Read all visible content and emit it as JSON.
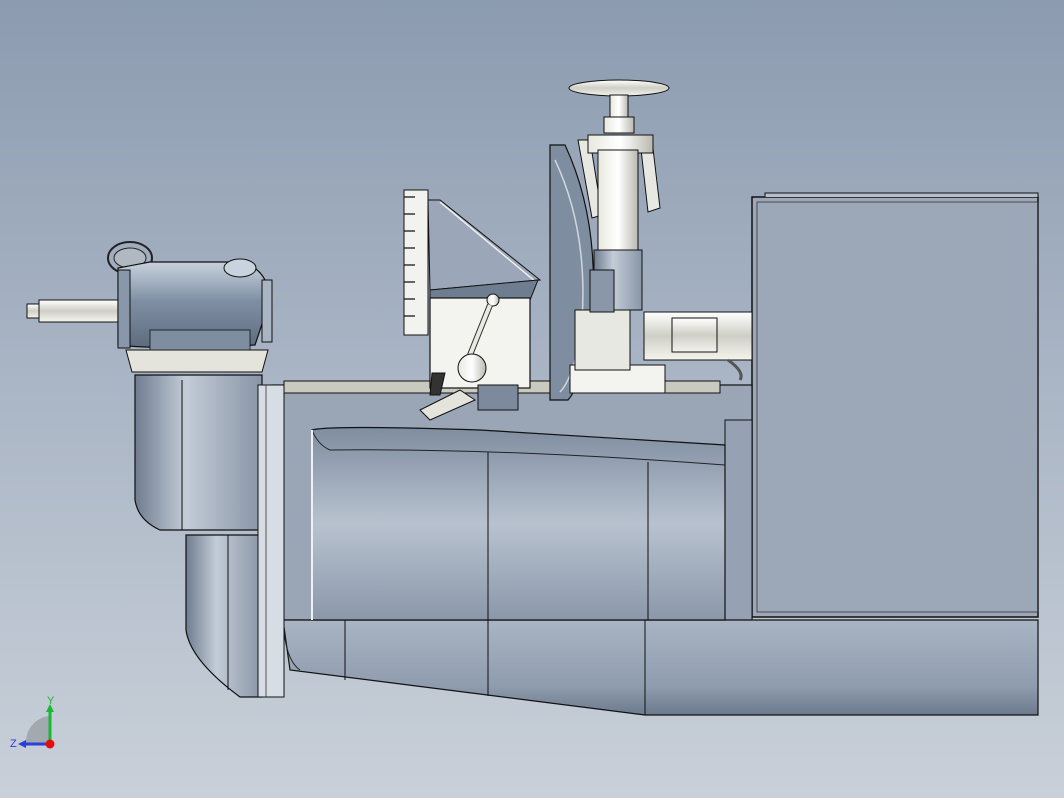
{
  "viewport": {
    "background_top": "#8c9bb0",
    "background_bottom": "#c9d0d9"
  },
  "triad": {
    "y_label": "Y",
    "z_label": "Z",
    "y_color": "#19b832",
    "z_color": "#2c3fd8",
    "x_color": "#e01010"
  },
  "model": {
    "body_color": "#9aa6b6",
    "edge_color": "#111111",
    "light_part_color": "#e6e6e0"
  }
}
